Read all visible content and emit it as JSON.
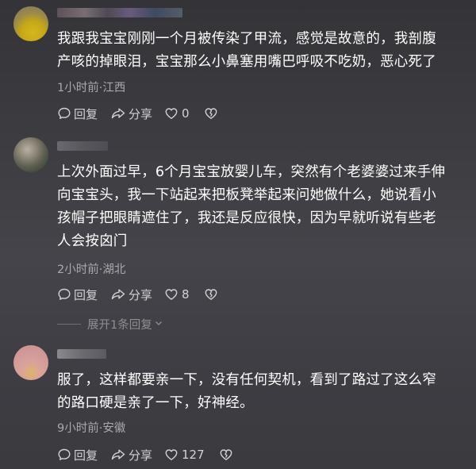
{
  "comments": [
    {
      "text": "我跟我宝宝刚刚一个月被传染了甲流，感觉是故意的，我剖腹\n产咳的掉眼泪，宝宝那么小鼻塞用嘴巴呼吸不吃奶，恶心死了",
      "meta": "1小时前·江西",
      "reply_label": "回复",
      "share_label": "分享",
      "like_count": "0"
    },
    {
      "text": "上次外面过早，6个月宝宝放婴儿车，突然有个老婆婆过来手伸\n向宝宝头，我一下站起来把板凳举起来问她做什么，她说看小\n孩帽子把眼睛遮住了，我还是反应很快，因为早就听说有些老\n人会按囟门",
      "meta": "2小时前·湖北",
      "reply_label": "回复",
      "share_label": "分享",
      "like_count": "8",
      "expand_label": "展开1条回复"
    },
    {
      "text": "服了，这样都要亲一下，没有任何契机，看到了路过了这么窄\n的路口硬是亲了一下，好神经。",
      "meta": "9小时前·安徽",
      "reply_label": "回复",
      "share_label": "分享",
      "like_count": "127"
    }
  ],
  "icons": {
    "reply": "comment-bubble-icon",
    "share": "share-arrow-icon",
    "like": "heart-outline-icon",
    "dislike": "broken-heart-icon",
    "expand": "chevron-down-icon"
  }
}
